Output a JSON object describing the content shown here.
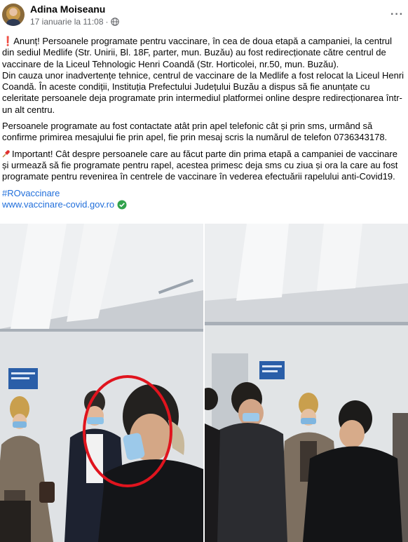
{
  "post": {
    "author": "Adina Moiseanu",
    "timestamp": "17 ianuarie la 11:08",
    "separator": "·",
    "more_label": "···",
    "paragraph1": "Anunț! Persoanele programate pentru vaccinare, în cea de doua etapă a campaniei, la centrul din sediul Medlife (Str. Unirii, Bl. 18F, parter, mun. Buzău) au fost redirecționate către centrul de vaccinare de la Liceul Tehnologic Henri Coandă (Str. Horticolei, nr.50, mun. Buzău).",
    "paragraph1b": "Din cauza unor inadvertențe tehnice, centrul de vaccinare de la Medlife a fost relocat la Liceul Henri Coandă. În aceste condiții, Instituția Prefectului Județului Buzău a dispus să fie anunțate cu celeritate persoanele deja programate prin intermediul platformei online despre redirecționarea într-un alt centru.",
    "paragraph2": "Persoanele programate au fost contactate atât prin apel telefonic cât și prin sms, urmând să confirme primirea mesajului fie prin apel, fie prin mesaj scris la numărul de telefon 0736343178.",
    "paragraph3": "Important! Cât despre persoanele care au făcut parte din prima etapă a campaniei de vaccinare și urmează să fie programate pentru rapel, acestea primesc deja sms cu ziua și ora la care au fost programate pentru revenirea în centrele de vaccinare în vederea efectuării rapelului anti-Covid19.",
    "hashtag": "#ROvaccinare",
    "link": "www.vaccinare-covid.gov.ro"
  },
  "icons": {
    "exclaim": "❗",
    "avatar": "avatar",
    "globe": "globe-icon",
    "pin": "pushpin-icon",
    "check": "check-circle-icon"
  },
  "colors": {
    "link": "#216fdb",
    "meta": "#65676b",
    "highlight_circle": "#e0141e",
    "check": "#31a24c"
  }
}
